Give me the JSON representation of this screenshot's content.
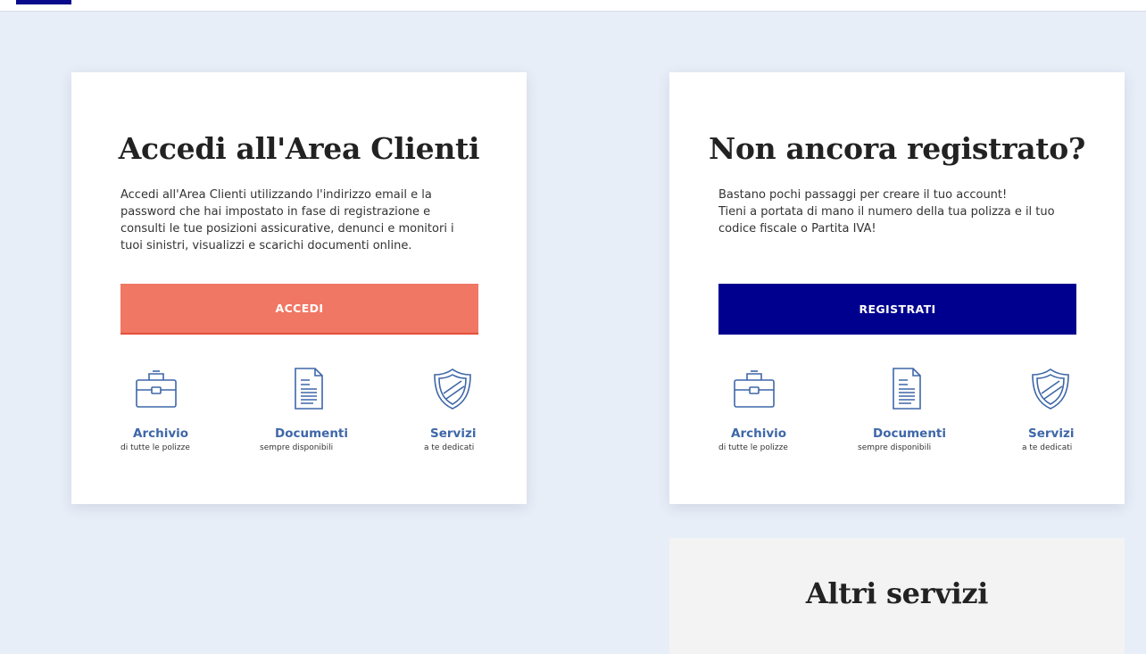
{
  "login": {
    "title": "Accedi all'Area Clienti",
    "description": "Accedi all'Area Clienti utilizzando l'indirizzo email e la password che hai impostato in fase di registrazione e consulti le tue posizioni assicurative, denunci e monitori i tuoi sinistri, visualizzi e scarichi documenti online.",
    "button_label": "ACCEDI"
  },
  "register": {
    "title": "Non ancora registrato?",
    "description": "Bastano pochi passaggi per creare il tuo account!\nTieni a portata di mano il numero della tua polizza e il tuo codice fiscale o Partita IVA!",
    "button_label": "REGISTRATI"
  },
  "features": [
    {
      "icon": "briefcase-icon",
      "title": "Archivio",
      "subtitle": "di tutte le polizze"
    },
    {
      "icon": "document-icon",
      "title": "Documenti",
      "subtitle": "sempre disponibili"
    },
    {
      "icon": "shield-icon",
      "title": "Servizi",
      "subtitle": "a te dedicati"
    }
  ],
  "other": {
    "title": "Altri servizi"
  },
  "colors": {
    "accent_coral": "#f07763",
    "brand_navy": "#00008f",
    "feature_blue": "#3e67a8",
    "background": "#e8eef8"
  }
}
